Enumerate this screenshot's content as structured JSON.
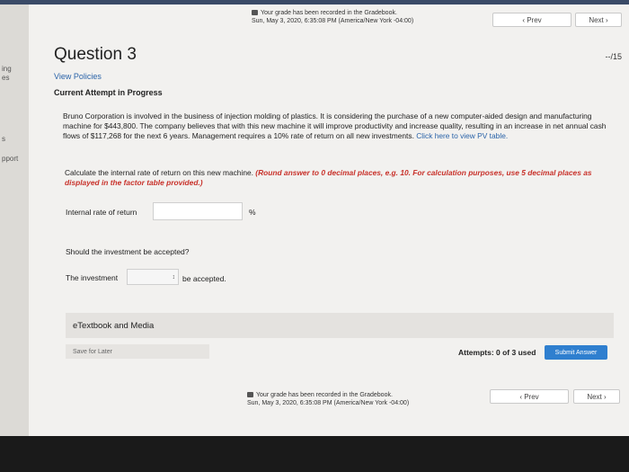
{
  "left_strip": [
    "ing",
    "es",
    "s",
    "pport"
  ],
  "banner_top": {
    "line1": "Your grade has been recorded in the Gradebook.",
    "line2": "Sun, May 3, 2020, 6:35:08 PM (America/New York -04:00)"
  },
  "nav": {
    "prev": "‹ Prev",
    "next": "Next ›"
  },
  "question": {
    "title": "Question 3",
    "score": "--/15",
    "view_policies": "View Policies",
    "attempt_status": "Current Attempt in Progress"
  },
  "problem": {
    "text": "Bruno Corporation is involved in the business of injection molding of plastics. It is considering the purchase of a new computer-aided design and manufacturing machine for $443,800. The company believes that with this new machine it will improve productivity and increase quality, resulting in an increase in net annual cash flows of $117,268 for the next 6 years. Management requires a 10% rate of return on all new investments.",
    "pv_link": "Click here to view PV table.",
    "instruction": "Calculate the internal rate of return on this new machine.",
    "instruction_note": "(Round answer to 0 decimal places, e.g. 10. For calculation purposes, use 5 decimal places as displayed in the factor table provided.)"
  },
  "irr": {
    "label": "Internal rate of return",
    "value": "",
    "unit": "%"
  },
  "accept": {
    "question": "Should the investment be accepted?",
    "prefix": "The investment",
    "selected": "",
    "suffix": "be accepted."
  },
  "etextbook": "eTextbook and Media",
  "actions": {
    "save_later": "Save for Later",
    "attempts": "Attempts: 0 of 3 used",
    "submit": "Submit Answer"
  },
  "banner_bottom": {
    "line1": "Your grade has been recorded in the Gradebook.",
    "line2": "Sun, May 3, 2020, 6:35:08 PM (America/New York -04:00)"
  }
}
